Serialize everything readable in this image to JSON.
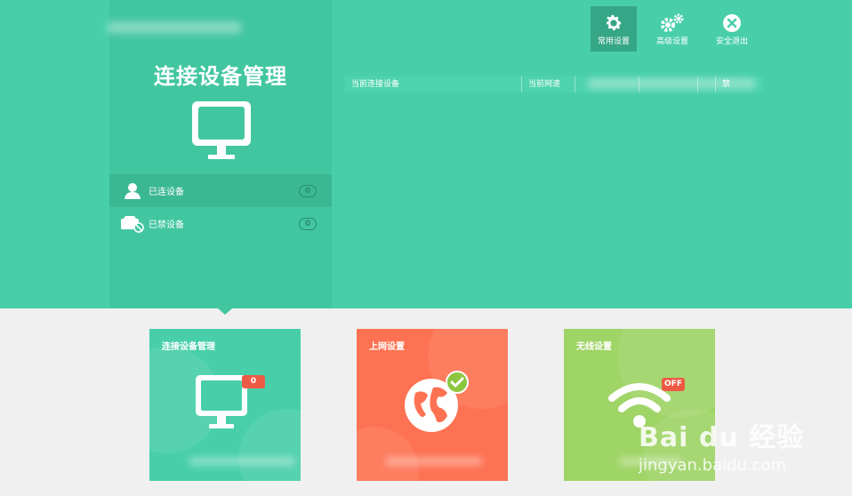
{
  "header": {
    "title": "连接设备管理",
    "buttons": [
      {
        "label": "常用设置",
        "icon": "gear-icon",
        "selected": true
      },
      {
        "label": "高级设置",
        "icon": "gears-icon",
        "selected": false
      },
      {
        "label": "安全退出",
        "icon": "close-circle-icon",
        "selected": false
      }
    ]
  },
  "sidebar": {
    "items": [
      {
        "label": "已连设备",
        "count": "0",
        "icon": "user-icon",
        "active": true
      },
      {
        "label": "已禁设备",
        "count": "0",
        "icon": "blocked-device-icon",
        "active": false
      }
    ]
  },
  "table": {
    "columns": [
      "当前连接设备",
      "当前网速",
      "",
      "",
      "",
      "禁"
    ]
  },
  "cards": [
    {
      "title": "连接设备管理",
      "badge": "0",
      "icon": "monitor-icon",
      "color": "#48cfa9"
    },
    {
      "title": "上网设置",
      "badge": "",
      "icon": "globe-check-icon",
      "color": "#fd7252"
    },
    {
      "title": "无线设置",
      "badge": "OFF",
      "icon": "wifi-icon",
      "color": "#9fd466"
    }
  ],
  "watermark": {
    "brand": "Bai du 经验",
    "url": "jingyan.baidu.com"
  },
  "colors": {
    "primary": "#48cfa9",
    "panel": "#42c6a0",
    "red": "#fd7252",
    "green": "#9fd466",
    "badge": "#ee5b45"
  }
}
